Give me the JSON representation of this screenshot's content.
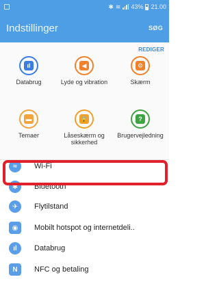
{
  "status_bar": {
    "bluetooth_glyph": "✱",
    "battery_percent": "43%",
    "time": "21.00"
  },
  "header": {
    "title": "Indstillinger",
    "search_label": "SØG"
  },
  "quick": {
    "edit_label": "REDIGER",
    "tiles": [
      {
        "label": "Databrug",
        "color": "#3b7ee0",
        "icon": "bar-chart-icon",
        "glyph": "ıl"
      },
      {
        "label": "Lyde og vibration",
        "color": "#f2812c",
        "icon": "volume-icon",
        "glyph": "◀"
      },
      {
        "label": "Skærm",
        "color": "#f2812c",
        "icon": "display-icon",
        "glyph": "⚙"
      },
      {
        "label": "Temaer",
        "color": "#f2a33a",
        "icon": "theme-brush-icon",
        "glyph": "▬"
      },
      {
        "label": "Låseskærm og sikkerhed",
        "color": "#f2a02a",
        "icon": "lock-icon",
        "glyph": "🔒"
      },
      {
        "label": "Brugervejledning",
        "color": "#3fa342",
        "icon": "help-icon",
        "glyph": "?"
      }
    ]
  },
  "list": [
    {
      "label": "Wi-Fi",
      "icon": "wifi-icon",
      "glyph": "≈"
    },
    {
      "label": "Bluetooth",
      "icon": "bluetooth-icon",
      "glyph": "✱"
    },
    {
      "label": "Flytilstand",
      "icon": "airplane-icon",
      "glyph": "✈"
    },
    {
      "label": "Mobilt hotspot og internetdeli..",
      "icon": "hotspot-icon",
      "glyph": "◉"
    },
    {
      "label": "Databrug",
      "icon": "data-usage-icon",
      "glyph": "ıl"
    },
    {
      "label": "NFC og betaling",
      "icon": "nfc-icon",
      "glyph": "N"
    }
  ],
  "accent_color": "#4e9ee6",
  "highlight_color": "#e0202a"
}
